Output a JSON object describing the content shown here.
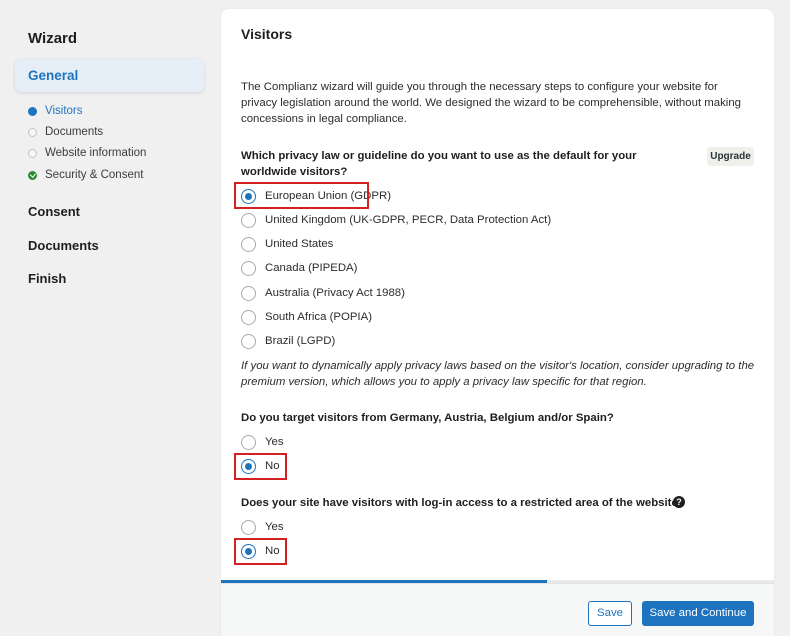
{
  "sidebar": {
    "title": "Wizard",
    "active_section": "General",
    "steps": [
      {
        "label": "Visitors",
        "state": "current"
      },
      {
        "label": "Documents",
        "state": "pending"
      },
      {
        "label": "Website information",
        "state": "pending"
      },
      {
        "label": "Security & Consent",
        "state": "done"
      }
    ],
    "sections": [
      "Consent",
      "Documents",
      "Finish"
    ]
  },
  "main": {
    "title": "Visitors",
    "intro": "The Complianz wizard will guide you through the necessary steps to configure your website for privacy legislation around the world. We designed the wizard to be comprehensible, without making concessions in legal compliance.",
    "q1": {
      "question": "Which privacy law or guideline do you want to use as the default for your worldwide visitors?",
      "badge": "Upgrade",
      "options": [
        "European Union (GDPR)",
        "United Kingdom (UK-GDPR, PECR, Data Protection Act)",
        "United States",
        "Canada (PIPEDA)",
        "Australia (Privacy Act 1988)",
        "South Africa (POPIA)",
        "Brazil (LGPD)"
      ],
      "selected": "European Union (GDPR)",
      "note": "If you want to dynamically apply privacy laws based on the visitor's location, consider upgrading to the premium version, which allows you to apply a privacy law specific for that region."
    },
    "q2": {
      "question": "Do you target visitors from Germany, Austria, Belgium and/or Spain?",
      "options": [
        "Yes",
        "No"
      ],
      "selected": "No"
    },
    "q3": {
      "question": "Does your site have visitors with log-in access to a restricted area of the website?",
      "help_icon": "?",
      "options": [
        "Yes",
        "No"
      ],
      "selected": "No"
    },
    "progress_percent": 59,
    "buttons": {
      "save": "Save",
      "save_continue": "Save and Continue"
    }
  },
  "colors": {
    "accent": "#1e73be",
    "done": "#2e8a37",
    "highlight": "#d32020"
  }
}
